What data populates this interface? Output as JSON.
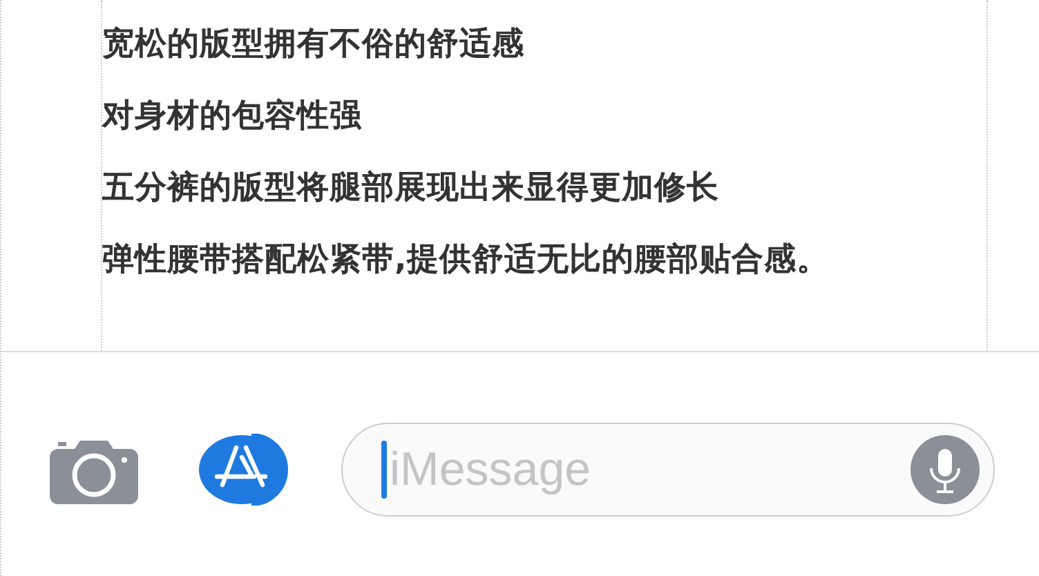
{
  "description_lines": [
    "宽松的版型拥有不俗的舒适感",
    "对身材的包容性强",
    "五分裤的版型将腿部展现出来显得更加修长",
    "弹性腰带搭配松紧带,提供舒适无比的腰部贴合感。"
  ],
  "message_bar": {
    "placeholder": "iMessage"
  }
}
